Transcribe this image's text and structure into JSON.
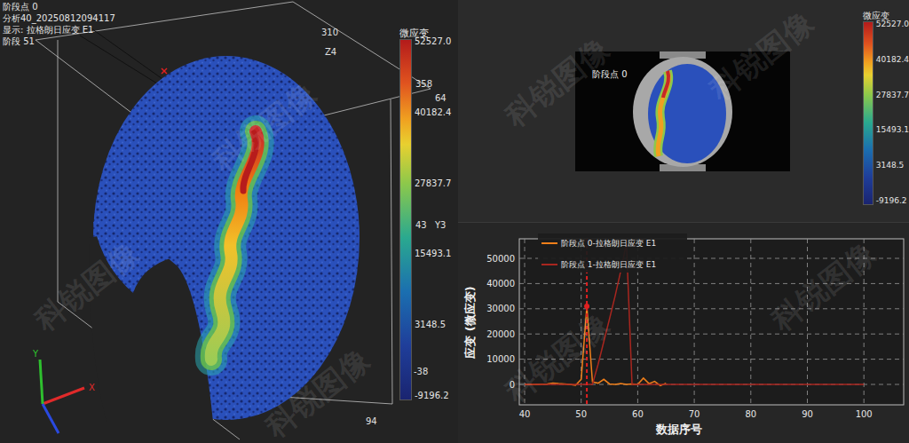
{
  "scene": {
    "info": [
      "阶段点 0",
      "分析40_20250812094117",
      "显示: 拉格朗日应变 E1",
      "阶段 51"
    ],
    "axis_labels": [
      "310",
      "Z4",
      "358",
      "64",
      "43",
      "Y3",
      "-38",
      "94"
    ],
    "triad": {
      "x": "X",
      "y": "Y"
    },
    "colorbar": {
      "title": "微应变",
      "ticks": [
        "52527.0",
        "40182.4",
        "27837.7",
        "15493.1",
        "3148.5",
        "-9196.2"
      ]
    }
  },
  "image_view": {
    "label": "阶段点 0",
    "colorbar": {
      "title": "微应变",
      "ticks": [
        "52527.0",
        "40182.4",
        "27837.7",
        "15493.1",
        "3148.5",
        "-9196.2"
      ]
    }
  },
  "chart": {
    "y_label": "应变 (微应变)",
    "x_label": "数据序号",
    "y_ticks": [
      "0",
      "10000",
      "20000",
      "30000",
      "40000",
      "50000"
    ],
    "x_ticks": [
      "40",
      "50",
      "60",
      "70",
      "80",
      "90",
      "100"
    ],
    "series": [
      {
        "name": "阶段点 0-拉格朗日应变 E1",
        "color": "#f07f1a",
        "start": 40,
        "values": [
          0,
          0,
          0,
          100,
          200,
          500,
          300,
          200,
          0,
          -300,
          2000,
          31000,
          1000,
          500,
          2000,
          200,
          0,
          300,
          0,
          200,
          0,
          2500,
          300,
          1200,
          -500,
          500
        ]
      },
      {
        "name": "阶段点 1-拉格朗日应变 E1",
        "color": "#a8261f",
        "start": 40,
        "values": [
          0,
          0,
          0,
          0,
          0,
          0,
          0,
          0,
          0,
          0,
          0,
          0,
          0,
          8000,
          17000,
          26000,
          35000,
          45000,
          56000,
          0,
          0,
          0,
          0,
          0,
          0,
          0,
          0,
          0,
          0,
          0,
          0,
          0,
          0,
          0,
          0,
          0,
          0,
          0,
          0,
          0,
          0,
          0,
          0,
          0,
          0,
          0,
          0,
          0,
          0,
          0,
          0,
          0,
          0,
          0,
          0,
          0,
          0,
          0,
          0,
          0,
          0
        ]
      }
    ],
    "cursor": {
      "index": 51,
      "series": 0
    }
  },
  "watermark": "科锐图像"
}
